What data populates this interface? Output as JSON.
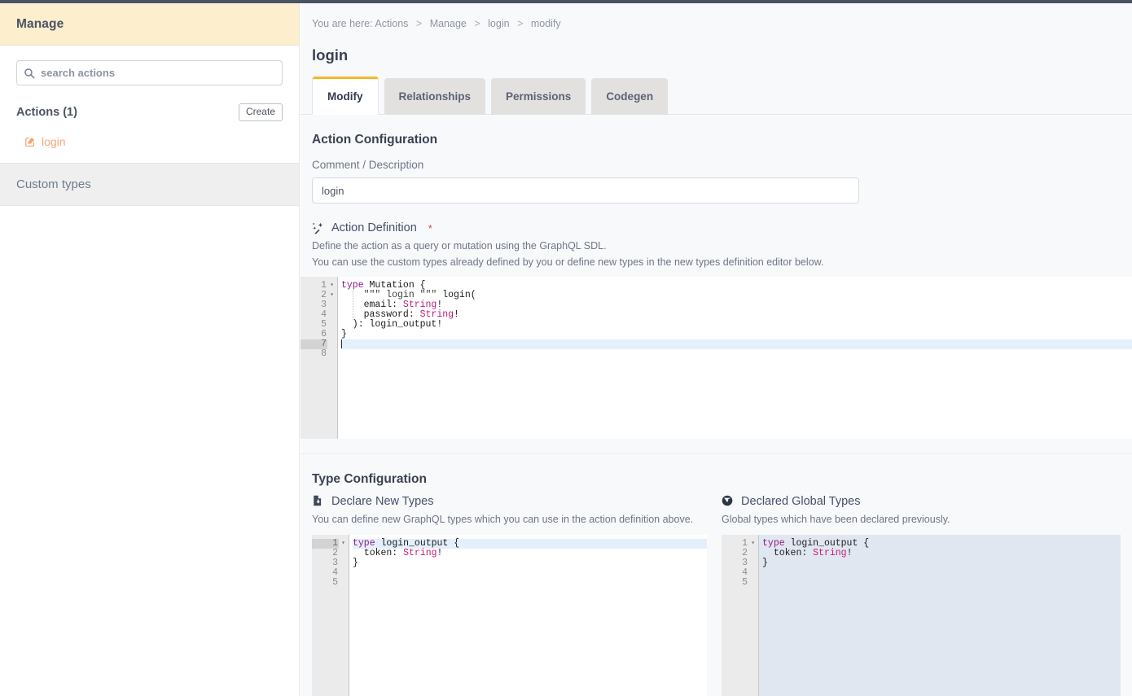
{
  "sidebar": {
    "header_title": "Manage",
    "search": {
      "placeholder": "search actions",
      "value": ""
    },
    "actions_title": "Actions (1)",
    "create_label": "Create",
    "items": [
      {
        "label": "login",
        "icon": "pencil-square-icon"
      }
    ],
    "custom_types_label": "Custom types"
  },
  "main": {
    "breadcrumb": {
      "prefix": "You are here:",
      "crumbs": [
        "Actions",
        "Manage",
        "login",
        "modify"
      ],
      "separator": ">"
    },
    "page_title": "login",
    "tabs": [
      {
        "label": "Modify",
        "active": true
      },
      {
        "label": "Relationships",
        "active": false
      },
      {
        "label": "Permissions",
        "active": false
      },
      {
        "label": "Codegen",
        "active": false
      }
    ],
    "action_configuration": {
      "section_title": "Action Configuration",
      "comment_label": "Comment / Description",
      "comment_value": "login",
      "comment_placeholder": "",
      "definition_title": "Action Definition",
      "definition_required_mark": "*",
      "definition_icon": "magic-wand-icon",
      "help_line_1": "Define the action as a query or mutation using the GraphQL SDL.",
      "help_line_2": "You can use the custom types already defined by you or define new types in the new types definition editor below.",
      "editor": {
        "active_line": 7,
        "total_lines": 8,
        "lines": [
          {
            "n": 1,
            "fold": true,
            "tokens": [
              {
                "t": "type ",
                "c": "kw"
              },
              {
                "t": "Mutation {",
                "c": "plain"
              }
            ]
          },
          {
            "n": 2,
            "fold": true,
            "tokens": [
              {
                "t": "    ",
                "c": "plain"
              },
              {
                "t": "\"\"\" login \"\"\"",
                "c": "doc"
              },
              {
                "t": " login(",
                "c": "plain"
              }
            ]
          },
          {
            "n": 3,
            "fold": false,
            "tokens": [
              {
                "t": "    email: ",
                "c": "plain"
              },
              {
                "t": "String",
                "c": "type"
              },
              {
                "t": "!",
                "c": "plain"
              }
            ]
          },
          {
            "n": 4,
            "fold": false,
            "tokens": [
              {
                "t": "    password: ",
                "c": "plain"
              },
              {
                "t": "String",
                "c": "type"
              },
              {
                "t": "!",
                "c": "plain"
              }
            ]
          },
          {
            "n": 5,
            "fold": false,
            "tokens": [
              {
                "t": "  ): login_output!",
                "c": "plain"
              }
            ]
          },
          {
            "n": 6,
            "fold": false,
            "tokens": [
              {
                "t": "}",
                "c": "plain"
              }
            ]
          },
          {
            "n": 7,
            "fold": false,
            "tokens": []
          },
          {
            "n": 8,
            "fold": false,
            "tokens": []
          }
        ]
      }
    },
    "type_configuration": {
      "section_title": "Type Configuration",
      "declare_new": {
        "title": "Declare New Types",
        "icon": "file-document-icon",
        "help": "You can define new GraphQL types which you can use in the action definition above.",
        "editor": {
          "active_line": 1,
          "total_lines": 5,
          "lines": [
            {
              "n": 1,
              "fold": true,
              "tokens": [
                {
                  "t": "type ",
                  "c": "kw"
                },
                {
                  "t": "login_output {",
                  "c": "plain"
                }
              ]
            },
            {
              "n": 2,
              "fold": false,
              "tokens": [
                {
                  "t": "  token: ",
                  "c": "plain"
                },
                {
                  "t": "String",
                  "c": "type"
                },
                {
                  "t": "!",
                  "c": "plain"
                }
              ]
            },
            {
              "n": 3,
              "fold": false,
              "tokens": [
                {
                  "t": "}",
                  "c": "plain"
                }
              ]
            },
            {
              "n": 4,
              "fold": false,
              "tokens": []
            },
            {
              "n": 5,
              "fold": false,
              "tokens": []
            }
          ]
        }
      },
      "declared_global": {
        "title": "Declared Global Types",
        "icon": "globe-icon",
        "help": "Global types which have been declared previously.",
        "editor": {
          "active_line": 0,
          "total_lines": 5,
          "lines": [
            {
              "n": 1,
              "fold": true,
              "tokens": [
                {
                  "t": "type ",
                  "c": "kw"
                },
                {
                  "t": "login_output {",
                  "c": "plain"
                }
              ]
            },
            {
              "n": 2,
              "fold": false,
              "tokens": [
                {
                  "t": "  token: ",
                  "c": "plain"
                },
                {
                  "t": "String",
                  "c": "type"
                },
                {
                  "t": "!",
                  "c": "plain"
                }
              ]
            },
            {
              "n": 3,
              "fold": false,
              "tokens": [
                {
                  "t": "}",
                  "c": "plain"
                }
              ]
            },
            {
              "n": 4,
              "fold": false,
              "tokens": []
            },
            {
              "n": 5,
              "fold": false,
              "tokens": []
            }
          ]
        }
      }
    }
  },
  "colors": {
    "sidebar_header_bg": "#fdeecd",
    "accent_orange": "#f5a173",
    "tab_active_border": "#f5b72c",
    "keyword": "#8b1a8b",
    "type": "#c41a7a",
    "active_line": "#e3effa",
    "readonly_editor_bg": "#e1e7f0"
  }
}
